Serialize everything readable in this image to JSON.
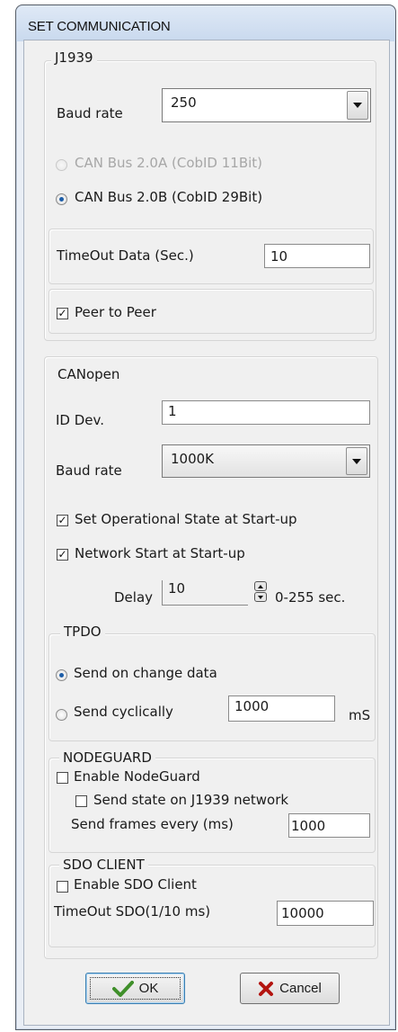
{
  "window": {
    "title": "SET COMMUNICATION"
  },
  "j1939": {
    "legend": "J1939",
    "baud_label": "Baud rate",
    "baud_value": "250",
    "radio_a_label": "CAN Bus 2.0A (CobID 11Bit)",
    "radio_a_selected": false,
    "radio_a_enabled": false,
    "radio_b_label": "CAN Bus 2.0B (CobID 29Bit)",
    "radio_b_selected": true,
    "timeout_label": "TimeOut Data  (Sec.)",
    "timeout_value": "10",
    "peer_label": "Peer to Peer",
    "peer_checked": true
  },
  "canopen": {
    "legend": "CANopen",
    "id_label": "ID Dev.",
    "id_value": "1",
    "baud_label": "Baud rate",
    "baud_value": "1000K",
    "set_op_label": "Set Operational State at Start-up",
    "set_op_checked": true,
    "net_start_label": "Network Start at Start-up",
    "net_start_checked": true,
    "delay_label": "Delay",
    "delay_value": "10",
    "delay_range": "0-255 sec."
  },
  "tpdo": {
    "legend": "TPDO",
    "on_change_label": "Send on change data",
    "on_change_selected": true,
    "cyclic_label": "Send cyclically",
    "cyclic_selected": false,
    "cyclic_value": "1000",
    "cyclic_unit": "mS"
  },
  "nodeguard": {
    "legend": "NODEGUARD",
    "enable_label": "Enable NodeGuard",
    "enable_checked": false,
    "send_state_label": "Send state on J1939 network",
    "send_state_checked": false,
    "frames_label": "Send frames every (ms)",
    "frames_value": "1000"
  },
  "sdo": {
    "legend": "SDO CLIENT",
    "enable_label": "Enable SDO Client",
    "enable_checked": false,
    "timeout_label": "TimeOut SDO(1/10 ms)",
    "timeout_value": "10000"
  },
  "buttons": {
    "ok_label": "OK",
    "cancel_label": "Cancel"
  },
  "icons": {
    "ok": "checkmark-icon",
    "cancel": "x-mark-icon",
    "ok_color": "#3f8f2a",
    "cancel_color": "#b3140f"
  }
}
